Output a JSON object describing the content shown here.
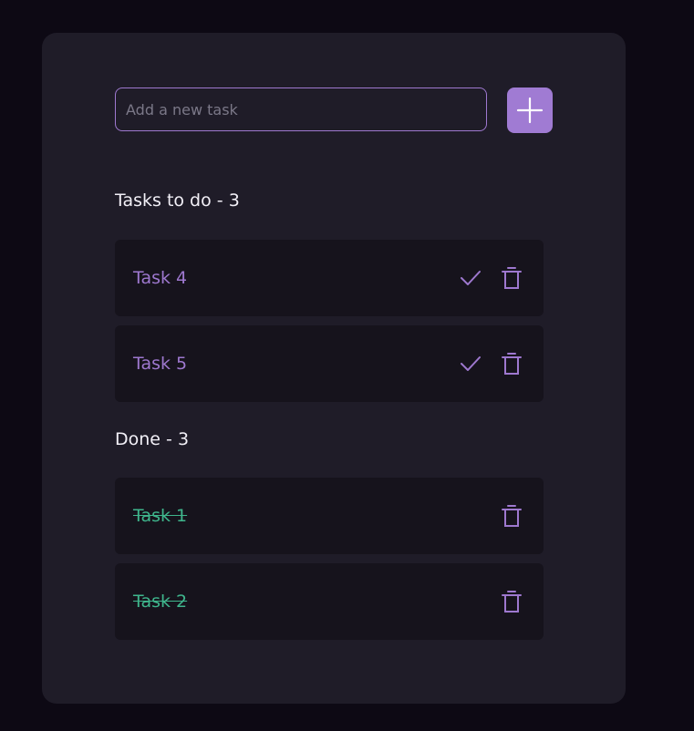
{
  "new_task": {
    "placeholder": "Add a new task",
    "value": "",
    "add_icon": "plus-icon"
  },
  "todo_section": {
    "title": "Tasks to do",
    "separator": " - ",
    "count": "3",
    "items": [
      {
        "label": "Task 4",
        "check_icon": "check-icon",
        "delete_icon": "trash-icon"
      },
      {
        "label": "Task 5",
        "check_icon": "check-icon",
        "delete_icon": "trash-icon"
      }
    ]
  },
  "done_section": {
    "title": "Done",
    "separator": " - ",
    "count": "3",
    "items": [
      {
        "label": "Task 1",
        "delete_icon": "trash-icon"
      },
      {
        "label": "Task 2",
        "delete_icon": "trash-icon"
      }
    ]
  },
  "colors": {
    "background": "#0d0914",
    "card": "#1f1c28",
    "item": "#16131c",
    "accent": "#9e78cf",
    "done": "#3fb58c",
    "text": "#f2f0f7"
  }
}
